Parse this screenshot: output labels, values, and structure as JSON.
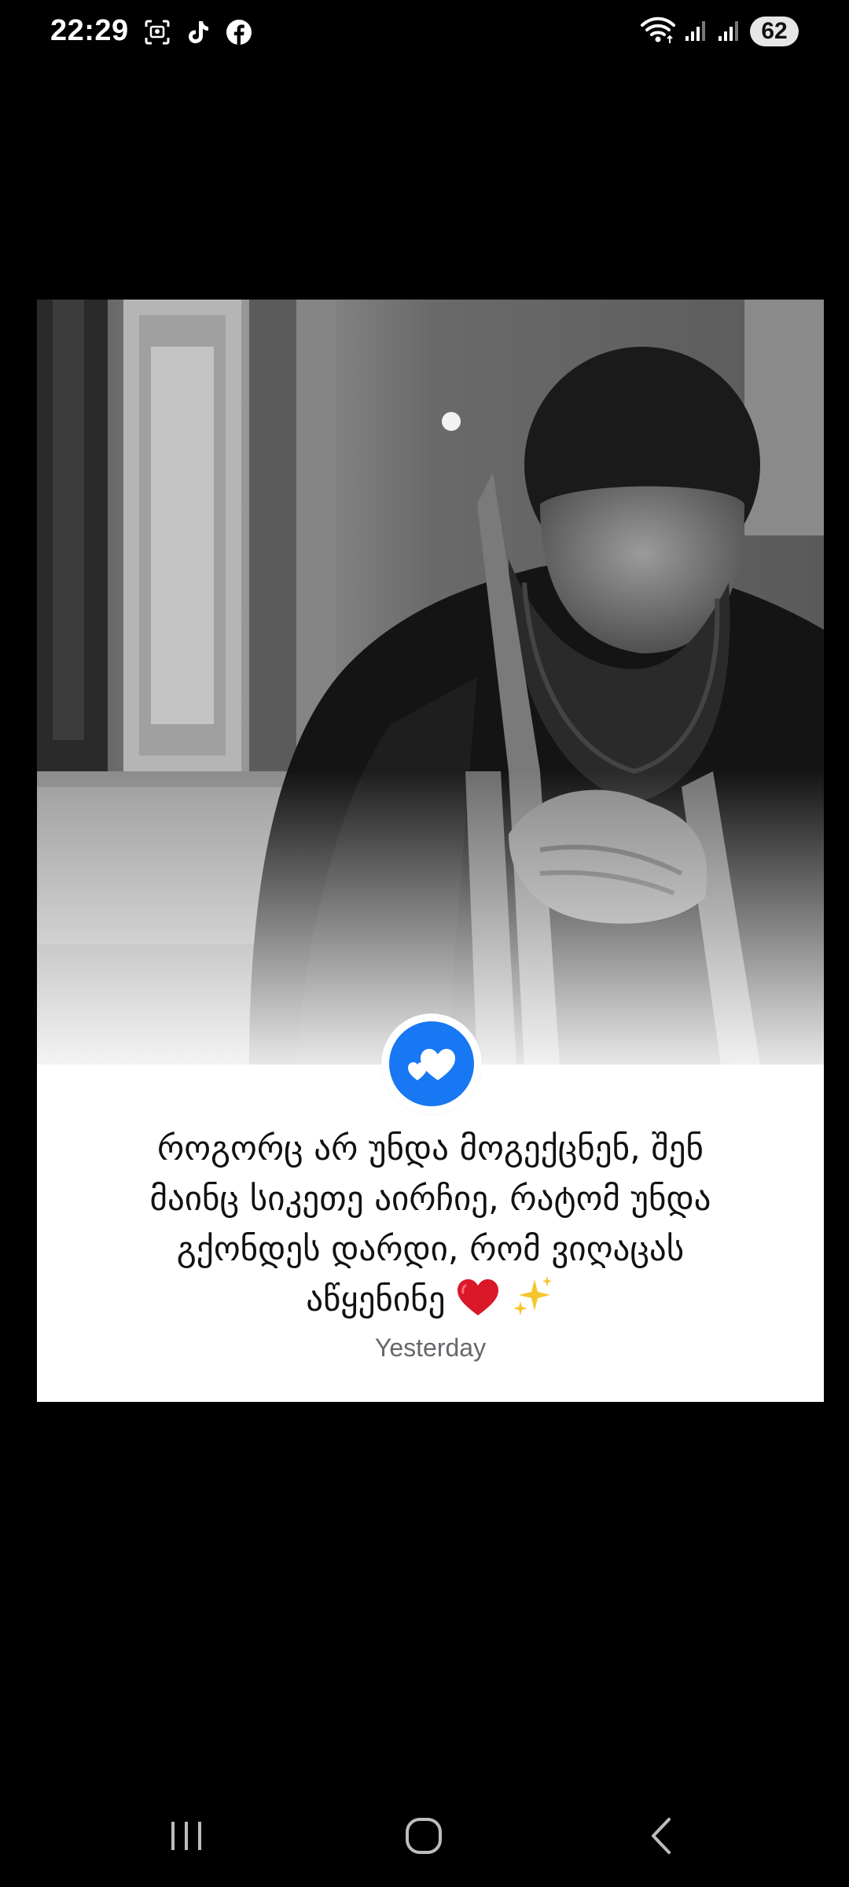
{
  "status_bar": {
    "time": "22:29",
    "battery": "62",
    "left_icons": [
      "screenshot-icon",
      "tiktok-icon",
      "facebook-icon"
    ],
    "right_icons": [
      "wifi-icon",
      "signal-icon",
      "signal-icon"
    ]
  },
  "post": {
    "text_line1": "როგორც არ უნდა მოგექცნენ, შენ",
    "text_line2": "მაინც სიკეთე აირჩიე, რატომ უნდა",
    "text_line3": "გქონდეს დარდი, რომ ვიღაცას",
    "text_line4": "აწყენინე",
    "timestamp": "Yesterday",
    "badge_icon": "double-heart-icon",
    "emojis": [
      "red-heart-icon",
      "sparkles-icon"
    ],
    "photo": "priest-praying-photo"
  },
  "colors": {
    "background": "#000000",
    "card": "#ffffff",
    "accent_blue": "#1877f2",
    "timestamp_gray": "#65676b"
  },
  "nav_bar": {
    "buttons": [
      "recents-button",
      "home-button",
      "back-button"
    ]
  }
}
